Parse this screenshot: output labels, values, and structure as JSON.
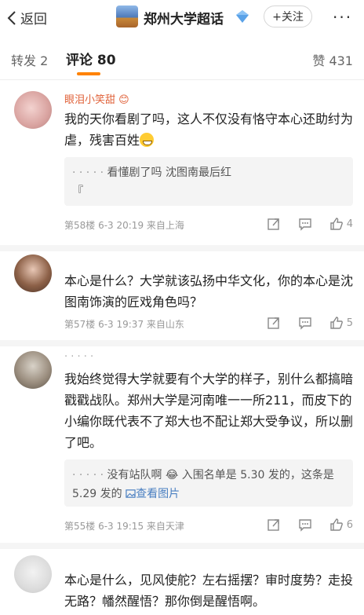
{
  "nav": {
    "back_label": "返回",
    "topic_title": "郑州大学超话",
    "follow_label": "+关注",
    "more_label": "···"
  },
  "tabs": {
    "repost": "转发 2",
    "comment": "评论 80",
    "like": "赞 431"
  },
  "comments": [
    {
      "username": "眼泪小笑甜 😊",
      "text": "我的天你看剧了吗，这人不仅没有恪守本心还助纣为虐，残害百姓",
      "reply_author": "· · · · ·",
      "reply_text": "看懂剧了吗 沈图南最后红",
      "reply_text_2": "『",
      "meta": "第58楼 6-3 20:19 来自上海",
      "like_count": "4"
    },
    {
      "username": "",
      "text": "本心是什么？大学就该弘扬中华文化，你的本心是沈图南饰演的匠戏角色吗？",
      "meta": "第57楼 6-3 19:37 来自山东",
      "like_count": "5"
    },
    {
      "username": "· · · · ·",
      "text": "我始终觉得大学就要有个大学的样子，别什么都搞暗戳戳战队。郑州大学是河南唯一一所211，而皮下的小编你既代表不了郑大也不配让郑大受争议，所以删了吧。",
      "reply_author": "· · · · ·",
      "reply_text": "没有站队啊 😂 入围名单是 5.30 发的，这条是 5.29 发的",
      "reply_link": "查看图片",
      "meta": "第55楼 6-3 19:15 来自天津",
      "like_count": "6"
    },
    {
      "username": "",
      "text": "本心是什么，见风使舵？左右摇摆？审时度势？走投无路？幡然醒悟？那你倒是醒悟啊。"
    }
  ],
  "colors": {
    "accent": "#ff8200",
    "username": "#e0623a",
    "link": "#4a7fc1"
  }
}
